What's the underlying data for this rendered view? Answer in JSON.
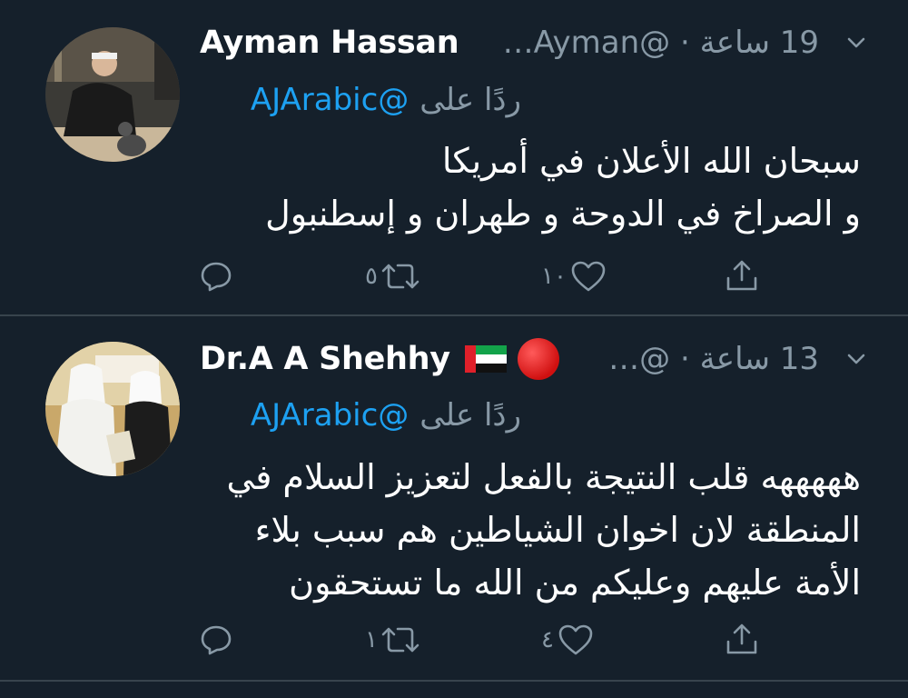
{
  "tweets": [
    {
      "author_name": "Ayman Hassan",
      "handle_time": "19 ساعة · @Ayman…",
      "reply_label": "ردًا على",
      "reply_mention": "@AJArabic",
      "text": "سبحان الله الأعلان في أمريكا\nو الصراخ في الدوحة و طهران و إسطنبول",
      "reply_count": "",
      "retweet_count": "٥",
      "like_count": "١٠",
      "icons": [
        "reply-icon",
        "retweet-icon",
        "like-icon",
        "share-icon",
        "chevron-down-icon"
      ]
    },
    {
      "author_name": "Dr.A A Shehhy",
      "handle_time": "13 ساعة · @…",
      "reply_label": "ردًا على",
      "reply_mention": "@AJArabic",
      "text": "هههههه قلب النتيجة بالفعل لتعزيز السلام في\nالمنطقة لان اخوان الشياطين هم سبب بلاء\nالأمة عليهم وعليكم من الله ما تستحقون",
      "reply_count": "",
      "retweet_count": "١",
      "like_count": "٤",
      "icons": [
        "uae-flag-icon",
        "red-circle-icon"
      ]
    }
  ],
  "colors": {
    "background": "#15202b",
    "secondary_text": "#8899a6",
    "link": "#1da1f2",
    "divider": "#38444d"
  }
}
